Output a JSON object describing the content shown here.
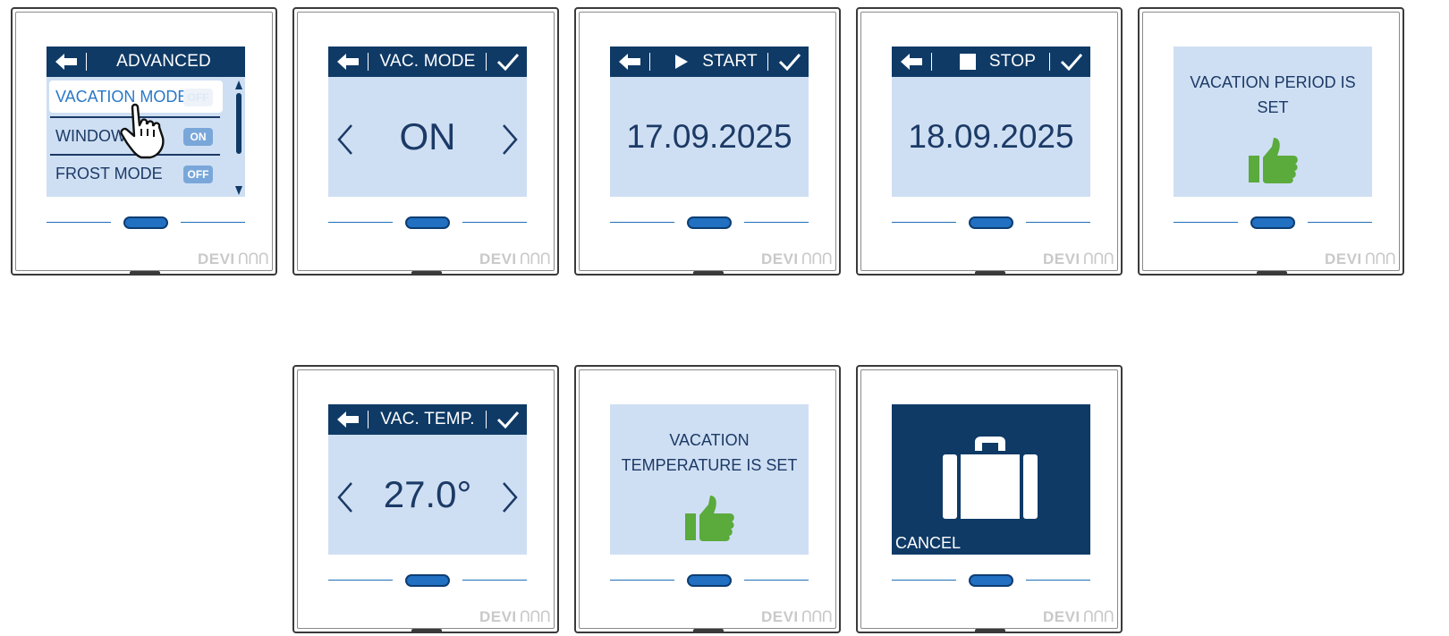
{
  "brand": {
    "name": "DEVI",
    "wave": "ᑎᑎᑎ"
  },
  "devices": {
    "d1": {
      "header_title": "ADVANCED",
      "rows": [
        {
          "label": "VACATION MODE",
          "toggle": "OFF"
        },
        {
          "label": "WINDOW",
          "toggle": "ON"
        },
        {
          "label": "FROST MODE",
          "toggle": "OFF"
        }
      ]
    },
    "d2": {
      "header_title": "VAC. MODE",
      "value": "ON"
    },
    "d3": {
      "header_title": "START",
      "value": "17.09.2025"
    },
    "d4": {
      "header_title": "STOP",
      "value": "18.09.2025"
    },
    "d5": {
      "message_line1": "VACATION PERIOD IS",
      "message_line2": "SET"
    },
    "d6": {
      "header_title": "VAC. TEMP.",
      "value": "27.0°"
    },
    "d7": {
      "message_line1": "VACATION",
      "message_line2": "TEMPERATURE IS SET"
    },
    "d8": {
      "cancel_label": "CANCEL"
    }
  },
  "colors": {
    "screen": "#cfdff3",
    "header": "#0f3a66",
    "accent": "#2170c2",
    "thumb": "#5aaa3c"
  },
  "icons": [
    "back-arrow-icon",
    "checkmark-icon",
    "chevron-left-icon",
    "chevron-right-icon",
    "play-icon",
    "stop-icon",
    "thumbs-up-icon",
    "suitcase-icon",
    "pointing-hand-icon"
  ]
}
